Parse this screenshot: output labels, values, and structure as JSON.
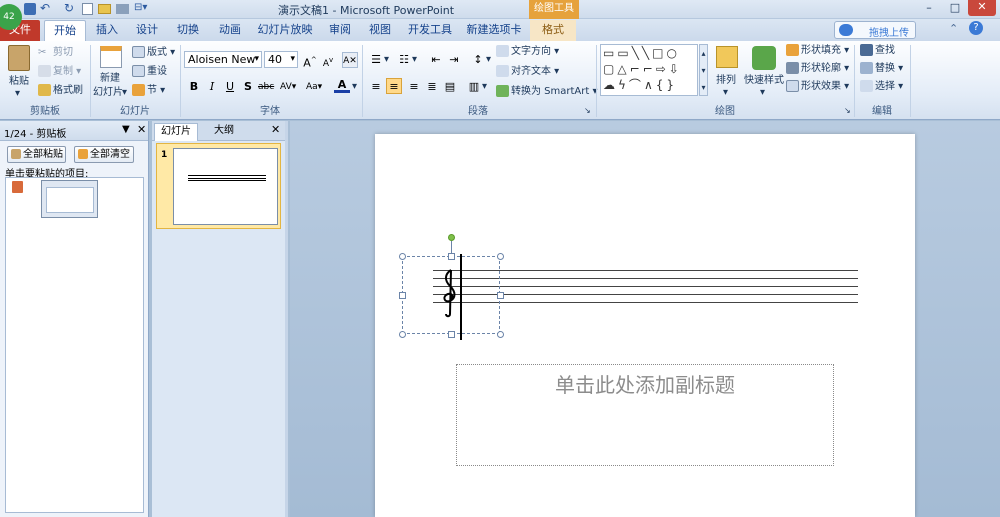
{
  "titlebar": {
    "title": "演示文稿1 - Microsoft PowerPoint",
    "badge": "42",
    "context_tab": "绘图工具"
  },
  "tabs": [
    {
      "label": "文件"
    },
    {
      "label": "开始"
    },
    {
      "label": "插入"
    },
    {
      "label": "设计"
    },
    {
      "label": "切换"
    },
    {
      "label": "动画"
    },
    {
      "label": "幻灯片放映"
    },
    {
      "label": "审阅"
    },
    {
      "label": "视图"
    },
    {
      "label": "开发工具"
    },
    {
      "label": "新建选项卡"
    },
    {
      "label": "格式"
    }
  ],
  "upload_label": "拖拽上传",
  "ribbon": {
    "clipboard": {
      "paste": "粘贴",
      "cut": "剪切",
      "copy": "复制",
      "painter": "格式刷",
      "group": "剪贴板"
    },
    "slides": {
      "new_slide": "新建",
      "new_slide2": "幻灯片",
      "layout": "版式",
      "reset": "重设",
      "section": "节",
      "group": "幻灯片"
    },
    "font": {
      "name": "Aloisen New",
      "size": "40",
      "group": "字体"
    },
    "paragraph": {
      "text_direction": "文字方向",
      "align_text": "对齐文本",
      "smartart": "转换为 SmartArt",
      "group": "段落"
    },
    "drawing": {
      "arrange": "排列",
      "quick_styles": "快速样式",
      "shape_fill": "形状填充",
      "shape_outline": "形状轮廓",
      "shape_effects": "形状效果",
      "group": "绘图"
    },
    "editing": {
      "find": "查找",
      "replace": "替换",
      "select": "选择",
      "group": "编辑"
    }
  },
  "clip_pane": {
    "title": "1/24 - 剪贴板",
    "paste_all": "全部粘贴",
    "clear_all": "全部清空",
    "hint": "单击要粘贴的项目:"
  },
  "slide_pane": {
    "tab_slides": "幻灯片",
    "tab_outline": "大纲",
    "slide_number": "1"
  },
  "slide": {
    "subtitle_placeholder": "单击此处添加副标题"
  },
  "colors": {
    "file_tab": "#c0392b",
    "context_tab": "#e6a23c",
    "ribbon_bg": "#e3ecf7",
    "selection": "#6b84a8"
  }
}
